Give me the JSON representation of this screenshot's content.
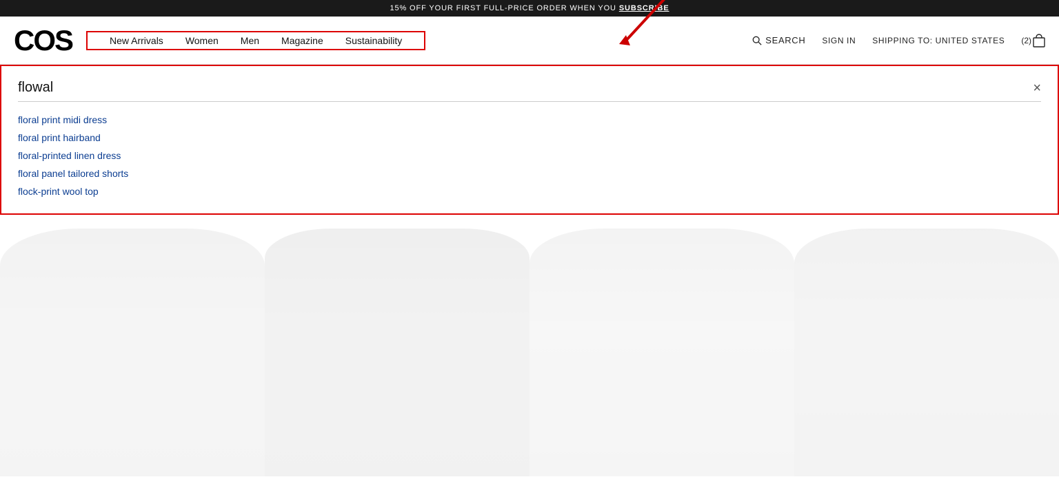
{
  "banner": {
    "text": "15% OFF YOUR FIRST FULL-PRICE ORDER WHEN YOU ",
    "link_text": "SUBSCRIBE"
  },
  "header": {
    "logo": "COS",
    "nav": {
      "items": [
        {
          "label": "New Arrivals",
          "id": "new-arrivals"
        },
        {
          "label": "Women",
          "id": "women"
        },
        {
          "label": "Men",
          "id": "men"
        },
        {
          "label": "Magazine",
          "id": "magazine"
        },
        {
          "label": "Sustainability",
          "id": "sustainability"
        }
      ]
    },
    "search_label": "SEARCH",
    "sign_in_label": "SIGN IN",
    "shipping_label": "SHIPPING TO: UNITED STATES",
    "cart_count": "(2)"
  },
  "search": {
    "input_value": "flowal",
    "close_label": "×",
    "suggestions": [
      "floral print midi dress",
      "floral print hairband",
      "floral-printed linen dress",
      "floral panel tailored shorts",
      "flock-print wool top"
    ]
  },
  "products": {
    "count": 4
  }
}
